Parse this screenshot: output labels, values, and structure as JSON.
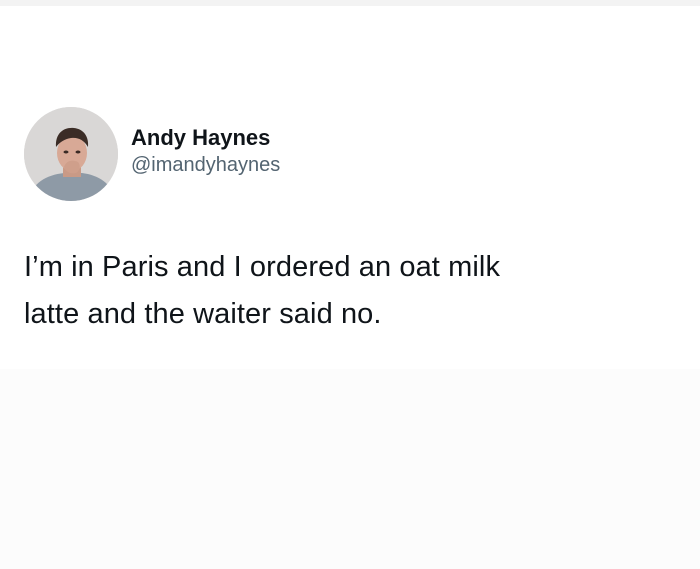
{
  "tweet": {
    "avatar_icon": "profile-photo",
    "display_name": "Andy Haynes",
    "handle": "@imandyhaynes",
    "text_lines": [
      "I’m in Paris and I ordered an oat milk",
      "latte and the waiter said no."
    ]
  },
  "colors": {
    "text_primary": "#0f1419",
    "text_secondary": "#536471",
    "background": "#ffffff"
  }
}
